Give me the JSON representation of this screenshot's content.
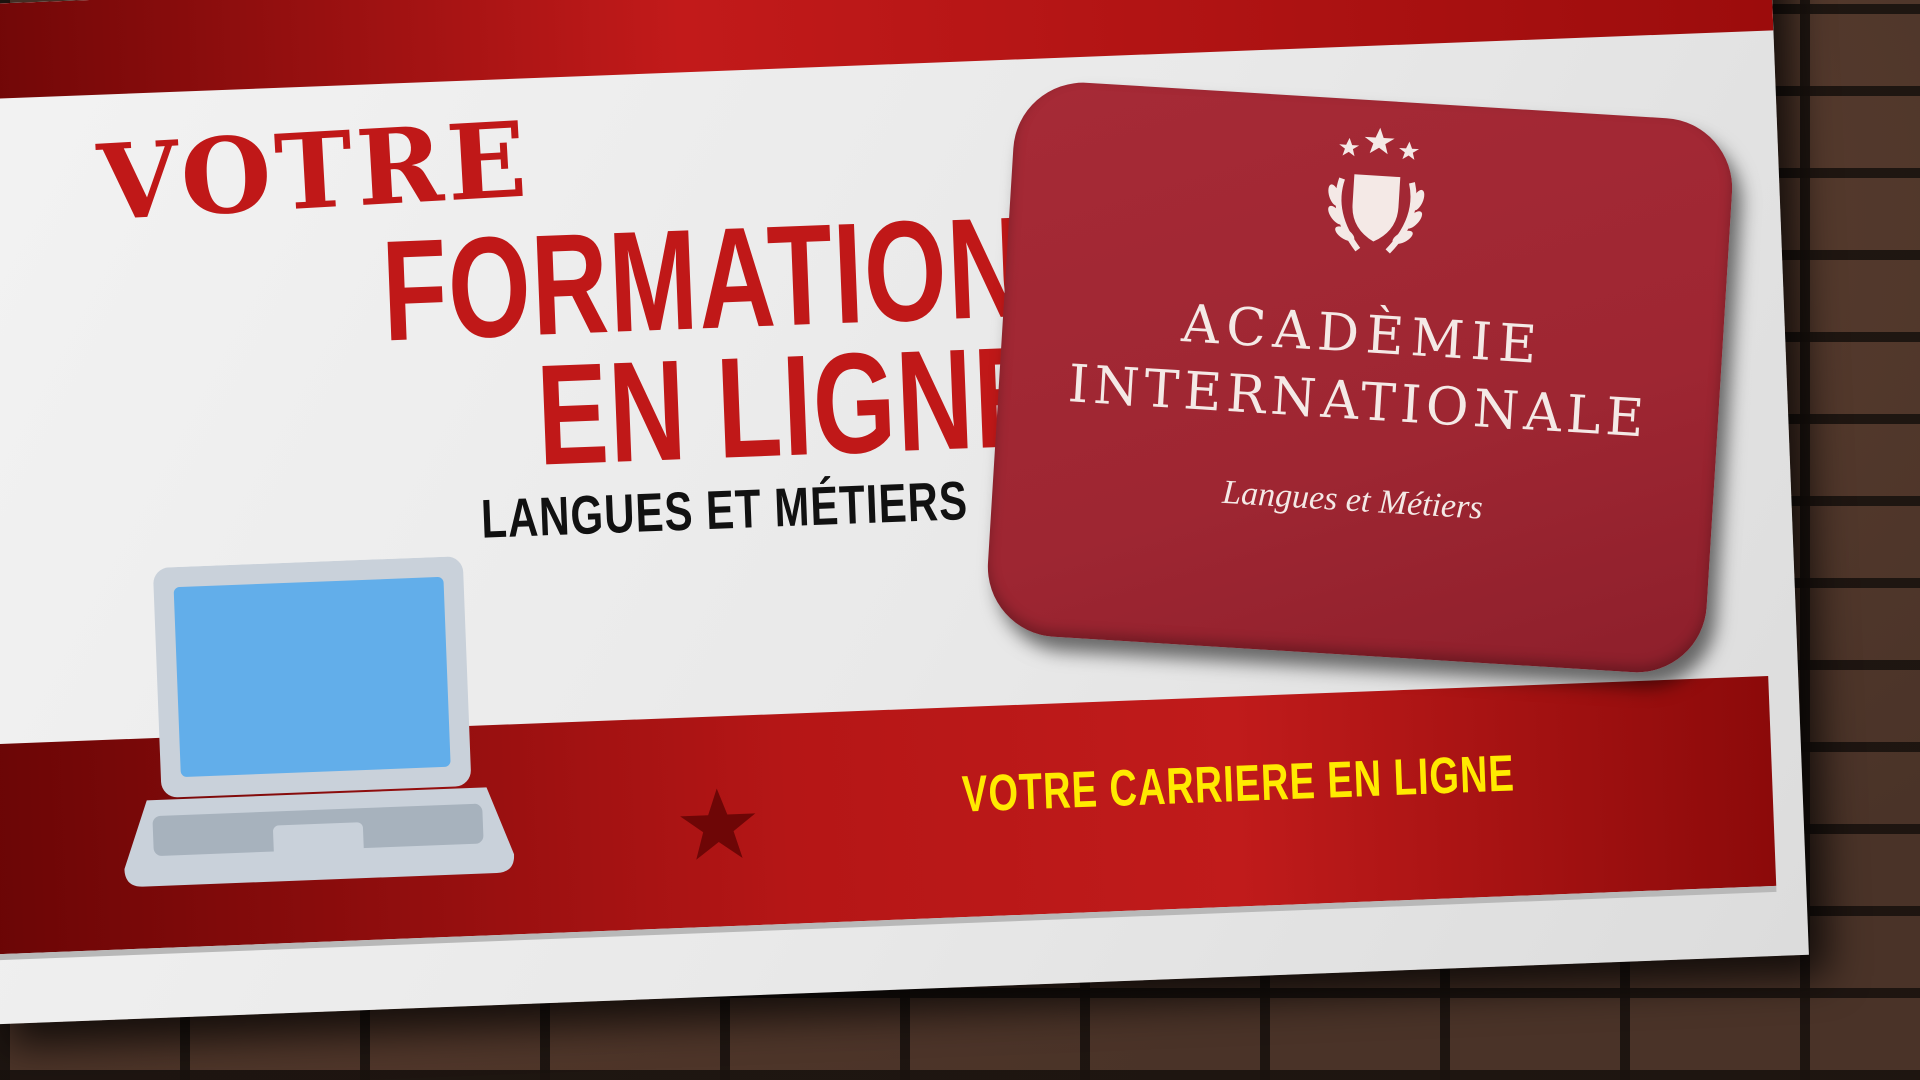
{
  "headline": {
    "line1": "VOTRE",
    "line2": "FORMATION",
    "line3": "EN LIGNE",
    "subtitle": "LANGUES ET MÉTIERS"
  },
  "logo": {
    "title_line1": "ACADÈMIE",
    "title_line2": "INTERNATIONALE",
    "subtitle": "Langues et Métiers",
    "icon": "shield-laurel-stars-emblem"
  },
  "banner": {
    "tagline": "VOTRE CARRIERE EN LIGNE"
  },
  "icons": {
    "laptop": "laptop-icon",
    "star": "star-icon"
  },
  "colors": {
    "brand_red": "#c01818",
    "badge_red": "#a62a36",
    "tagline_yellow": "#ffea00",
    "laptop_screen": "#62aeea"
  }
}
